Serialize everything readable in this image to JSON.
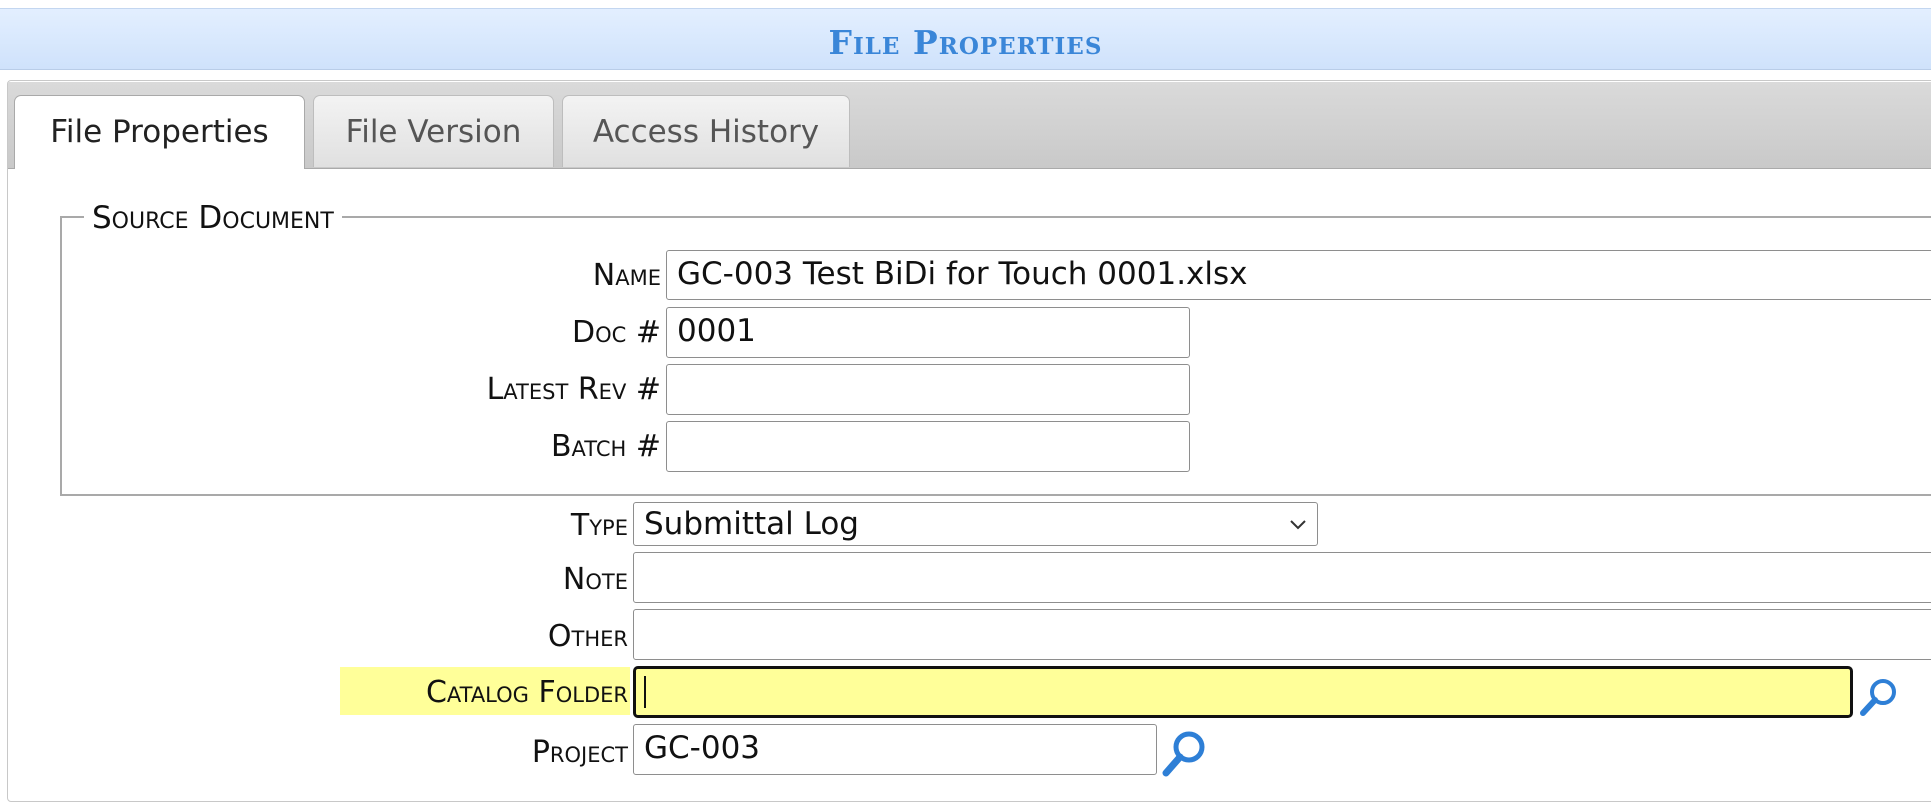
{
  "window": {
    "title": "File Properties"
  },
  "tabs": [
    {
      "label": "File Properties",
      "active": true
    },
    {
      "label": "File Version",
      "active": false
    },
    {
      "label": "Access History",
      "active": false
    }
  ],
  "source_document": {
    "legend": "Source Document",
    "name": {
      "label": "Name",
      "value": "GC-003 Test BiDi for Touch 0001.xlsx"
    },
    "doc_no": {
      "label": "Doc #",
      "value": "0001"
    },
    "latest_rev": {
      "label": "Latest Rev #",
      "value": ""
    },
    "batch": {
      "label": "Batch #",
      "value": ""
    }
  },
  "details": {
    "type": {
      "label": "Type",
      "value": "Submittal Log"
    },
    "note": {
      "label": "Note",
      "value": ""
    },
    "other": {
      "label": "Other",
      "value": ""
    },
    "catalog_folder": {
      "label": "Catalog Folder",
      "value": ""
    },
    "project": {
      "label": "Project",
      "value": "GC-003"
    }
  },
  "colors": {
    "title": "#3a86d8",
    "highlight": "#ffff99",
    "icon": "#2e7fd6"
  },
  "icons": [
    "search-icon",
    "chevron-down-icon"
  ]
}
